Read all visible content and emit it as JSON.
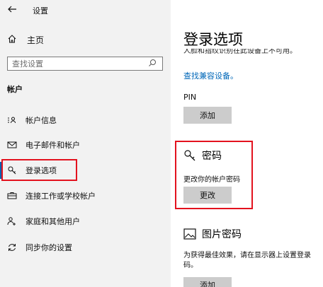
{
  "header": {
    "title": "设置",
    "back_icon": "back-arrow-icon"
  },
  "sidebar": {
    "home_label": "主页",
    "search_placeholder": "查找设置",
    "section_title": "帐户",
    "items": [
      {
        "label": "帐户信息",
        "icon": "account-info-icon",
        "selected": false
      },
      {
        "label": "电子邮件和帐户",
        "icon": "email-icon",
        "selected": false
      },
      {
        "label": "登录选项",
        "icon": "key-icon",
        "selected": true
      },
      {
        "label": "连接工作或学校帐户",
        "icon": "briefcase-icon",
        "selected": false
      },
      {
        "label": "家庭和其他用户",
        "icon": "person-add-icon",
        "selected": false
      },
      {
        "label": "同步你的设置",
        "icon": "sync-icon",
        "selected": false
      }
    ]
  },
  "main": {
    "title": "登录选项",
    "clipped_text": "人脸和指纹识别在此设备上不可用。",
    "compat_link": "查找兼容设备。",
    "pin": {
      "label": "PIN",
      "add_button": "添加"
    },
    "password": {
      "title": "密码",
      "description": "更改你的帐户密码",
      "change_button": "更改"
    },
    "picture_password": {
      "title": "图片密码",
      "description": "为获得最佳效果，请在显示器上设置登录码。",
      "add_button": "添加"
    }
  },
  "colors": {
    "accent": "#0063b1",
    "link": "#0067b8",
    "highlight": "#e3121e",
    "sidebar_bg": "#f2f2f2",
    "button_bg": "#cccccc"
  }
}
